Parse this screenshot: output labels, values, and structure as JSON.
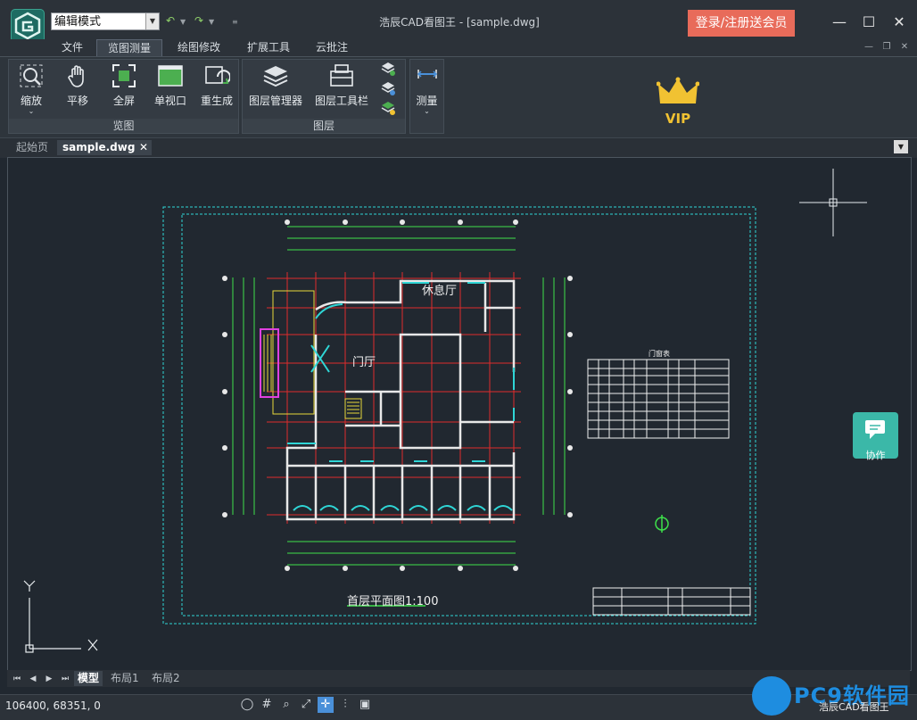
{
  "window": {
    "title": "浩辰CAD看图王 - [sample.dwg]",
    "mode_select": "编辑模式",
    "login_button": "登录/注册送会员"
  },
  "menu": {
    "tabs": [
      {
        "label": "文件"
      },
      {
        "label": "览图测量"
      },
      {
        "label": "绘图修改"
      },
      {
        "label": "扩展工具"
      },
      {
        "label": "云批注"
      }
    ]
  },
  "ribbon": {
    "view_group": {
      "label": "览图",
      "buttons": [
        {
          "label": "缩放",
          "icon": "zoom-icon"
        },
        {
          "label": "平移",
          "icon": "hand-icon"
        },
        {
          "label": "全屏",
          "icon": "fullscreen-icon"
        },
        {
          "label": "单视口",
          "icon": "single-viewport-icon"
        },
        {
          "label": "重生成",
          "icon": "regenerate-icon"
        }
      ]
    },
    "layer_group": {
      "label": "图层",
      "buttons": [
        {
          "label": "图层管理器",
          "icon": "layer-manager-icon"
        },
        {
          "label": "图层工具栏",
          "icon": "layer-toolbar-icon"
        }
      ]
    },
    "measure": {
      "label": "测量",
      "icon": "measure-icon"
    },
    "vip_badge": "VIP"
  },
  "doc_tabs": [
    {
      "label": "起始页"
    },
    {
      "label": "sample.dwg"
    }
  ],
  "drawing": {
    "room_lounge": "休息厅",
    "room_hall": "门厅",
    "plan_title": "首层平面图1:100",
    "door_table_title": "门窗表"
  },
  "collab_button": "协作",
  "layout_tabs": [
    {
      "label": "模型"
    },
    {
      "label": "布局1"
    },
    {
      "label": "布局2"
    }
  ],
  "status": {
    "coordinates": "106400, 68351, 0"
  },
  "watermark": {
    "brand": "PC9软件园",
    "sub": "浩辰CAD看图王"
  },
  "colors": {
    "accent_login": "#e86b5a",
    "collab": "#3bb8a8",
    "cad_background": "#212830",
    "vip_gold": "#f1c232"
  }
}
